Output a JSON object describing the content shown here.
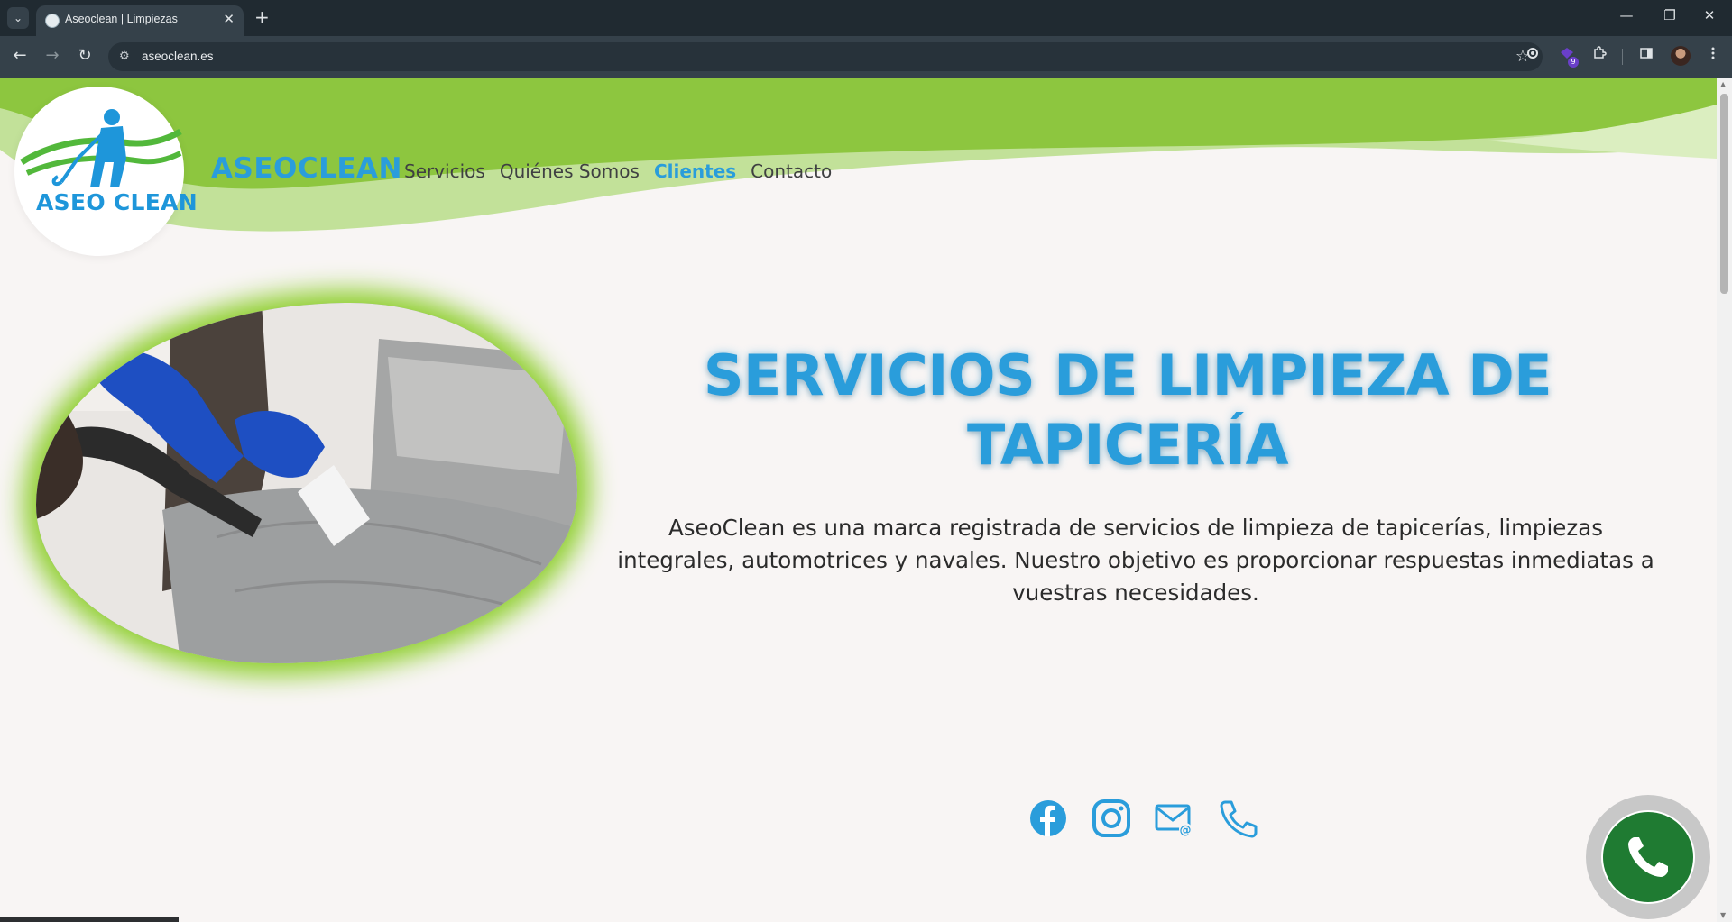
{
  "browser": {
    "tab_title": "Aseoclean | Limpiezas",
    "tab_close": "✕",
    "new_tab": "+",
    "url": "aseoclean.es",
    "extension_badge": "9",
    "window": {
      "minimize": "—",
      "restore": "❐",
      "close": "✕"
    },
    "icons": {
      "back": "←",
      "forward": "→",
      "reload": "↻",
      "star": "☆",
      "tab_menu": "⌄",
      "site_info": "⚙"
    }
  },
  "header": {
    "logo_text": "ASEO CLEAN",
    "brand": "ASEOCLEAN",
    "nav": [
      "Servicios",
      "Quiénes Somos",
      "Clientes",
      "Contacto"
    ],
    "active_nav": "Clientes"
  },
  "hero": {
    "title_line1": "SERVICIOS DE LIMPIEZA DE",
    "title_line2": "TAPICERÍA",
    "description": "AseoClean es una marca registrada de servicios de limpieza de tapicerías, limpiezas integrales, automotrices y navales. Nuestro objetivo es proporcionar respuestas inmediatas a vuestras necesidades."
  },
  "socials": [
    "facebook-icon",
    "instagram-icon",
    "email-icon",
    "phone-icon"
  ],
  "colors": {
    "primary_blue": "#2a9ddb",
    "green": "#8dc63f",
    "light_green": "#c2e199",
    "whatsapp_green": "#1f7b32",
    "page_bg": "#f8f5f4",
    "chrome_dark": "#202a31",
    "chrome_toolbar": "#35414a"
  }
}
